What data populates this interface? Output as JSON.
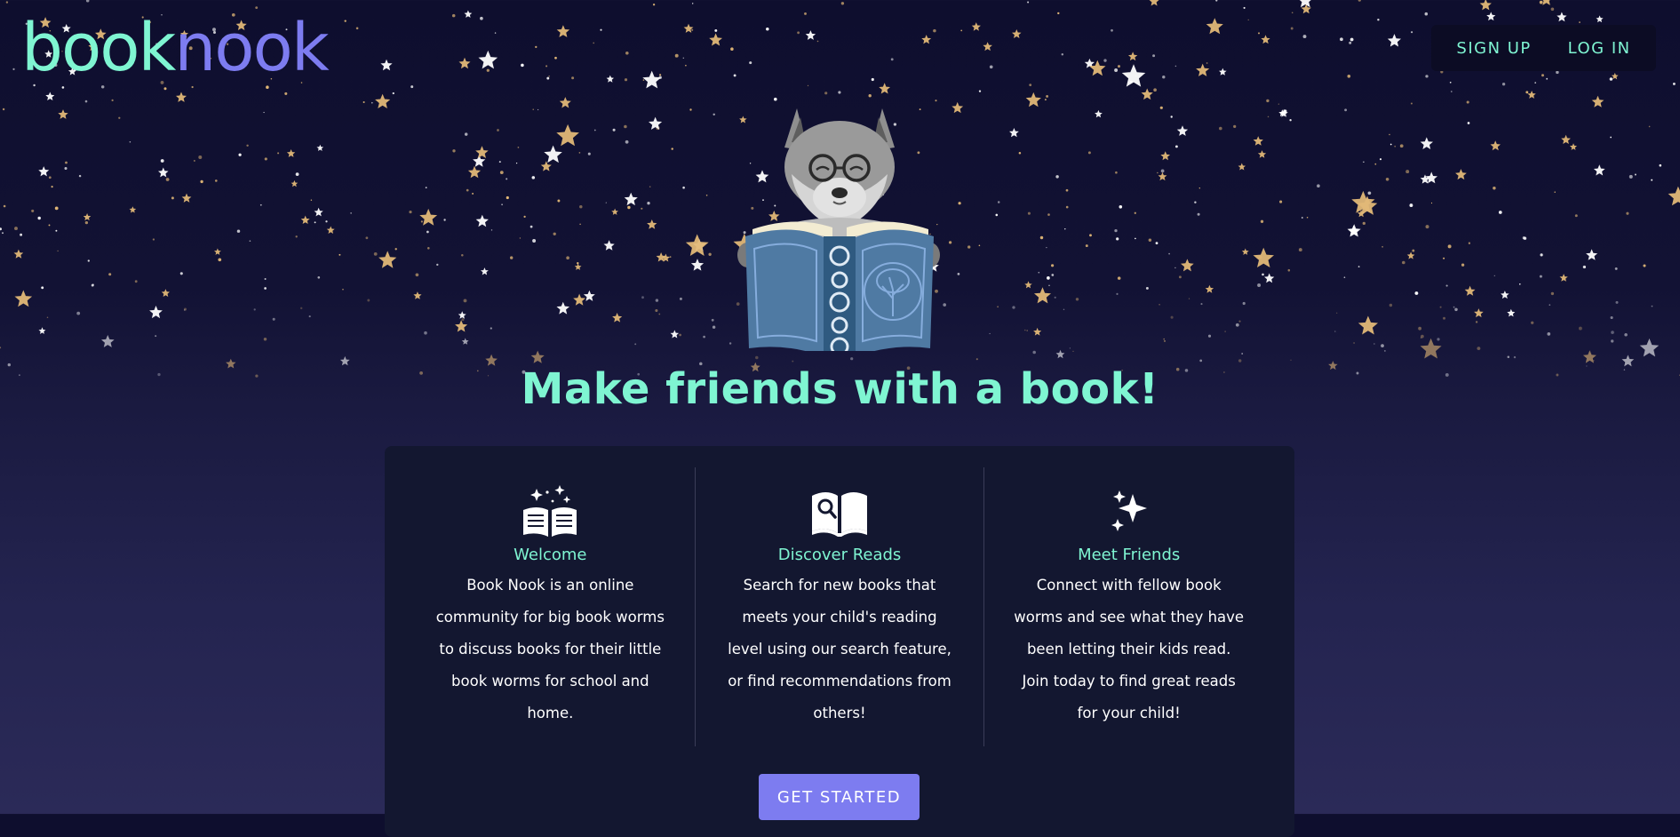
{
  "brand": {
    "logo_part1": "book",
    "logo_part2": "nook"
  },
  "nav": {
    "sign_up": "SIGN UP",
    "log_in": "LOG IN"
  },
  "hero": {
    "headline": "Make friends with a book!",
    "mascot": "wolf-reading-book-illustration"
  },
  "features": [
    {
      "icon": "open-book-sparkles-icon",
      "title": "Welcome",
      "text": "Book Nook is an online community for big book worms to discuss books for their little book worms for school and home."
    },
    {
      "icon": "book-search-icon",
      "title": "Discover Reads",
      "text": "Search for new books that meets your child's reading level using our search feature, or find recommendations from others!"
    },
    {
      "icon": "sparkles-icon",
      "title": "Meet Friends",
      "text": "Connect with fellow book worms and see what they have been letting their kids read. Join today to find great reads for your child!"
    }
  ],
  "cta": {
    "label": "GET STARTED"
  },
  "colors": {
    "accent_mint": "#7ff5d2",
    "accent_purple": "#7d7cf0",
    "card_bg": "#131730",
    "star_gold": "#e2b877"
  }
}
